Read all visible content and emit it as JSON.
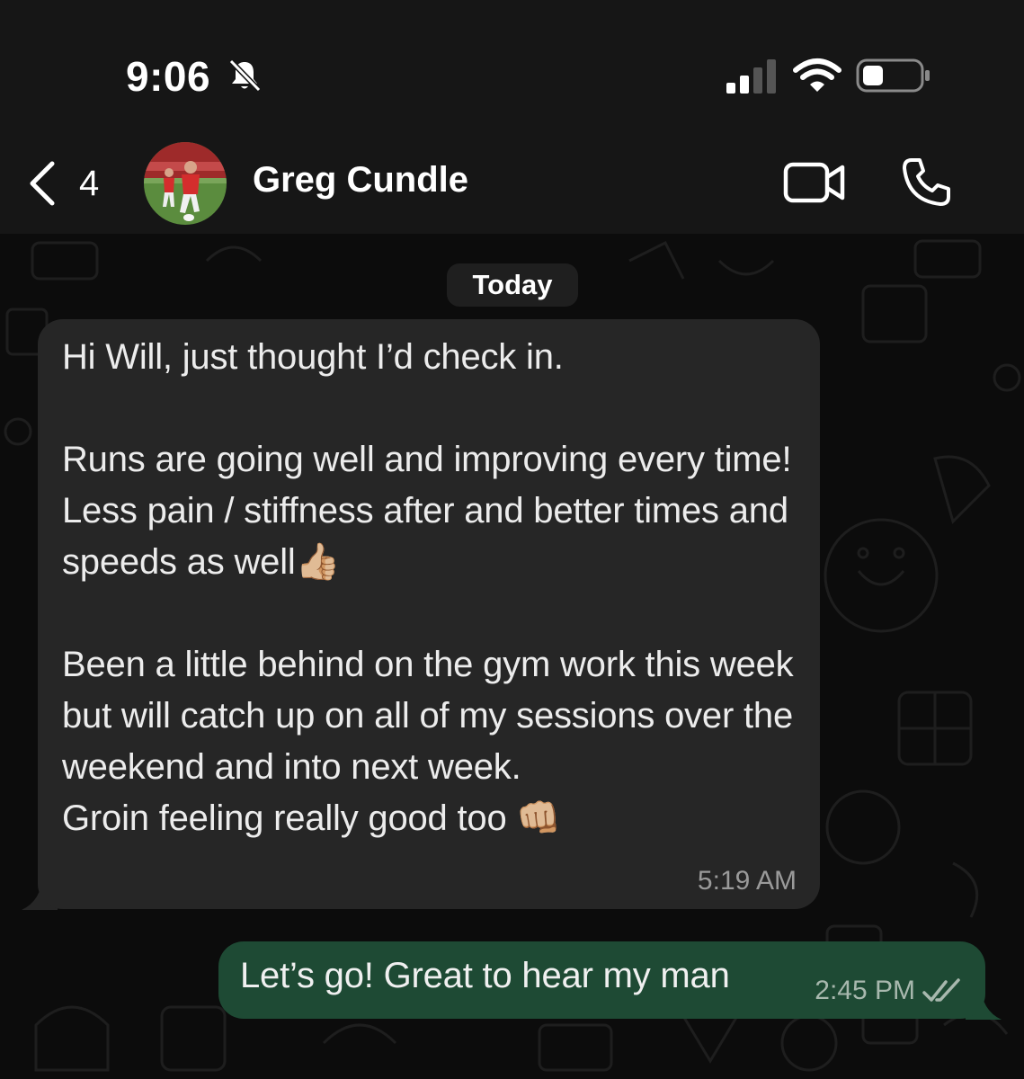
{
  "status_bar": {
    "time": "9:06",
    "bell_icon": "bell-slash-icon",
    "signal_icon": "cellular-signal-icon",
    "wifi_icon": "wifi-icon",
    "battery_icon": "battery-icon"
  },
  "header": {
    "back_count": "4",
    "contact_name": "Greg Cundle",
    "video_icon": "video-camera-icon",
    "call_icon": "phone-icon"
  },
  "chat": {
    "date_chip": "Today",
    "messages": [
      {
        "direction": "incoming",
        "text": "Hi Will, just thought I’d check in.\n\nRuns are going well and improving every time! Less pain / stiffness after and better times and speeds as well👍🏼\n\nBeen a little behind on the gym work this week but will catch up on all of my sessions over the weekend and into next week.\nGroin feeling really good too 👊🏼",
        "time": "5:19 AM"
      },
      {
        "direction": "outgoing",
        "text": "Let’s go! Great to hear my man",
        "time": "2:45 PM",
        "status_icon": "double-check-read-icon"
      }
    ]
  },
  "colors": {
    "header_bg": "#161616",
    "chat_bg": "#0c0c0c",
    "incoming_bubble": "#262626",
    "outgoing_bubble": "#1e4a34"
  }
}
